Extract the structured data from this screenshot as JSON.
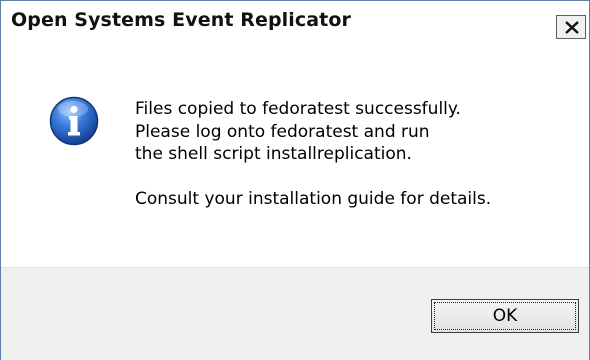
{
  "dialog": {
    "title": "Open Systems Event Replicator",
    "close_icon": "close-icon",
    "message_icon": "info-icon",
    "message_lines": [
      "Files copied to fedoratest successfully.",
      "Please log onto fedoratest and run",
      "the shell script installreplication."
    ],
    "message_note": "Consult your installation guide for details.",
    "ok_label": "OK"
  },
  "colors": {
    "window_border": "#5a7fa8",
    "footer_background": "#f0f0f0",
    "icon_blue": "#1f5fbf"
  }
}
